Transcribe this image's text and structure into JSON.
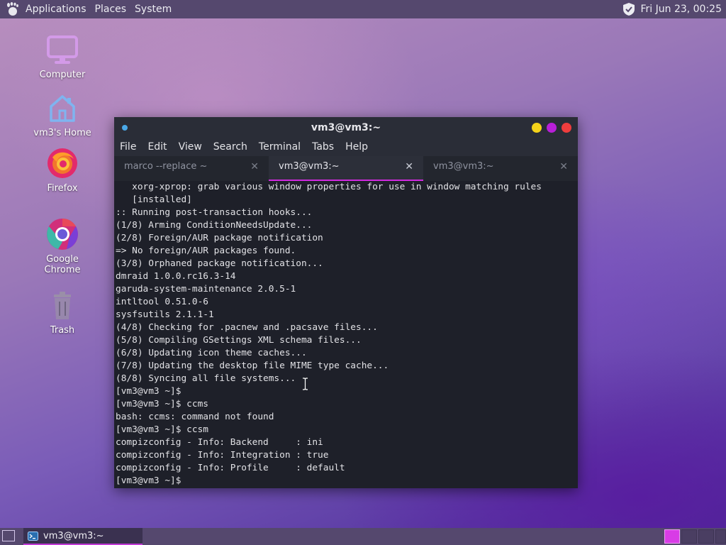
{
  "top_panel": {
    "menu": [
      "Applications",
      "Places",
      "System"
    ],
    "clock": "Fri Jun 23, 00:25"
  },
  "desktop_icons": [
    {
      "label": "Computer",
      "icon": "monitor-icon"
    },
    {
      "label": "vm3's Home",
      "icon": "home-icon"
    },
    {
      "label": "Firefox",
      "icon": "firefox-icon"
    },
    {
      "label": "Google Chrome",
      "icon": "chrome-icon"
    },
    {
      "label": "Trash",
      "icon": "trash-icon"
    }
  ],
  "terminal": {
    "title": "vm3@vm3:~",
    "menu": [
      "File",
      "Edit",
      "View",
      "Search",
      "Terminal",
      "Tabs",
      "Help"
    ],
    "tabs": [
      {
        "label": "marco --replace ~",
        "active": false
      },
      {
        "label": "vm3@vm3:~",
        "active": true
      },
      {
        "label": "vm3@vm3:~",
        "active": false
      }
    ],
    "lines": [
      "   xorg-xprop: grab various window properties for use in window matching rules",
      "   [installed]",
      ":: Running post-transaction hooks...",
      "(1/8) Arming ConditionNeedsUpdate...",
      "(2/8) Foreign/AUR package notification",
      "=> No foreign/AUR packages found.",
      "(3/8) Orphaned package notification...",
      "dmraid 1.0.0.rc16.3-14",
      "garuda-system-maintenance 2.0.5-1",
      "intltool 0.51.0-6",
      "sysfsutils 2.1.1-1",
      "(4/8) Checking for .pacnew and .pacsave files...",
      "(5/8) Compiling GSettings XML schema files...",
      "(6/8) Updating icon theme caches...",
      "(7/8) Updating the desktop file MIME type cache...",
      "(8/8) Syncing all file systems...",
      "[vm3@vm3 ~]$",
      "[vm3@vm3 ~]$ ccms",
      "bash: ccms: command not found",
      "[vm3@vm3 ~]$ ccsm",
      "compizconfig - Info: Backend     : ini",
      "compizconfig - Info: Integration : true",
      "compizconfig - Info: Profile     : default",
      "[vm3@vm3 ~]$"
    ],
    "scroll_position": 1.0
  },
  "taskbar": {
    "items": [
      {
        "label": "vm3@vm3:~",
        "icon": "terminal-icon"
      }
    ],
    "workspaces": 4,
    "active_workspace": 1
  },
  "colors": {
    "panel": "#55486e",
    "accent": "#d02ae0",
    "terminal_bg": "#1e2029"
  }
}
